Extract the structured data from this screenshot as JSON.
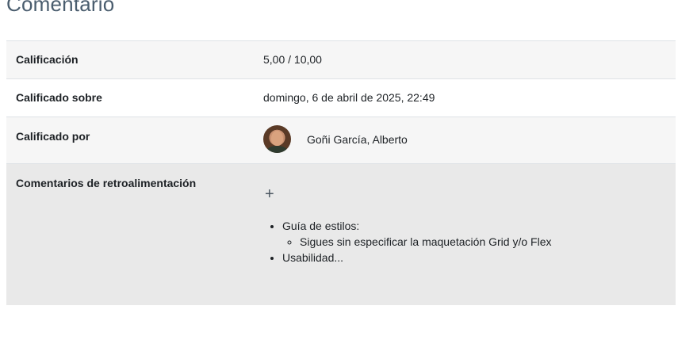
{
  "section": {
    "title": "Comentario"
  },
  "rows": {
    "grade": {
      "label": "Calificación",
      "value": "5,00 / 10,00"
    },
    "graded_on": {
      "label": "Calificado sobre",
      "value": "domingo, 6 de abril de 2025, 22:49"
    },
    "graded_by": {
      "label": "Calificado por",
      "name": "Goñi García, Alberto"
    },
    "feedback": {
      "label": "Comentarios de retroalimentación",
      "expand_icon": "plus-icon",
      "items": [
        {
          "text": "Guía de estilos:",
          "subitems": [
            "Sigues sin especificar la maquetación Grid y/o Flex"
          ]
        },
        {
          "text": "Usabilidad..."
        }
      ]
    }
  }
}
